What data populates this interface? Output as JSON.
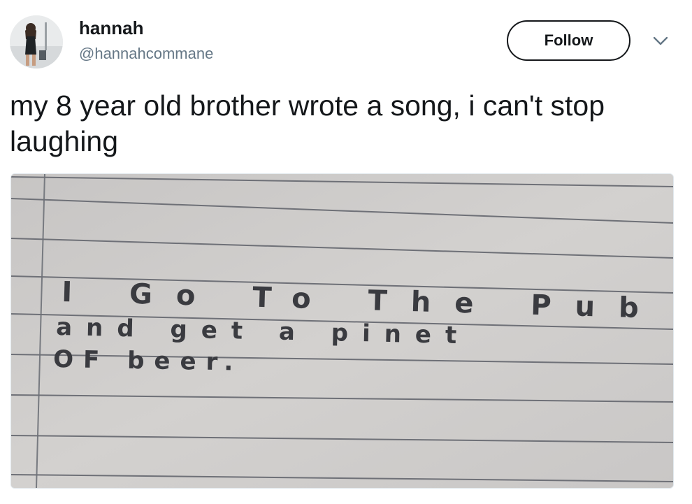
{
  "tweet": {
    "author": {
      "name": "hannah",
      "handle": "@hannahcommane",
      "avatar_icon": "profile-photo"
    },
    "follow_label": "Follow",
    "menu_icon": "chevron-down-icon",
    "text": "my 8 year old brother wrote a song, i can't stop laughing",
    "media": {
      "type": "photo of handwritten lined paper",
      "handwritten_lines": [
        "I Go To The Pub",
        "and get a pinet",
        "OF beer."
      ]
    }
  },
  "colors": {
    "text_primary": "#14171a",
    "text_secondary": "#657786",
    "paper": "#cfcdcb",
    "rule_line": "#6e7077",
    "pencil": "#3a3b40"
  }
}
